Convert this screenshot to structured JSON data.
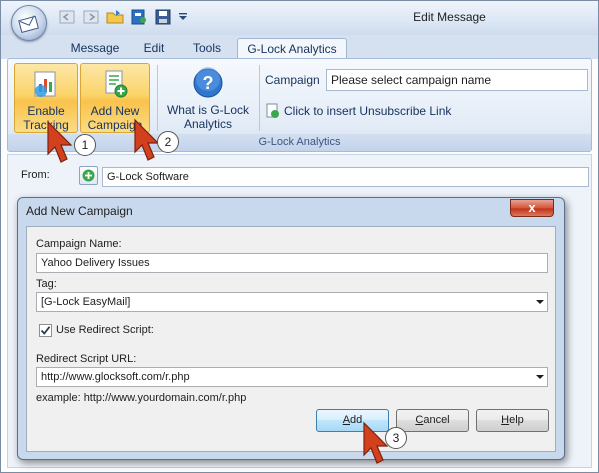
{
  "window": {
    "title": "Edit Message"
  },
  "quick_access": {
    "icons": [
      "back-icon",
      "forward-icon",
      "open-folder-icon",
      "address-book-icon",
      "save-icon"
    ]
  },
  "tabs": [
    {
      "label": "Message",
      "active": false
    },
    {
      "label": "Edit",
      "active": false
    },
    {
      "label": "Tools",
      "active": false
    },
    {
      "label": "G-Lock Analytics",
      "active": true
    }
  ],
  "ribbon": {
    "enable_tracking": {
      "line1": "Enable",
      "line2": "Tracking"
    },
    "add_new_campaign": {
      "line1": "Add New",
      "line2": "Campaign"
    },
    "what_is": {
      "line1": "What is G-Lock",
      "line2": "Analytics"
    },
    "campaign_label": "Campaign",
    "campaign_value": "Please select campaign name",
    "unsubscribe_link": "Click to insert Unsubscribe Link",
    "group_label": "G-Lock Analytics"
  },
  "message": {
    "from_label": "From:",
    "from_value": "G-Lock Software"
  },
  "dialog": {
    "title": "Add New Campaign",
    "close_label": "x",
    "campaign_name_label": "Campaign Name:",
    "campaign_name_value": "Yahoo Delivery Issues",
    "tag_label": "Tag:",
    "tag_value": "[G-Lock EasyMail]",
    "use_redirect_label": "Use Redirect Script:",
    "use_redirect_checked": true,
    "redirect_url_label": "Redirect Script URL:",
    "redirect_url_value": "http://www.glocksoft.com/r.php",
    "example_text": "example: http://www.yourdomain.com/r.php",
    "buttons": {
      "add": "Add",
      "cancel": "Cancel",
      "help": "Help"
    }
  },
  "callouts": [
    "1",
    "2",
    "3"
  ],
  "colors": {
    "accent_orange": "#f9c24c",
    "ribbon_blue": "#d5e1f1",
    "pointer_red": "#d2401e"
  }
}
